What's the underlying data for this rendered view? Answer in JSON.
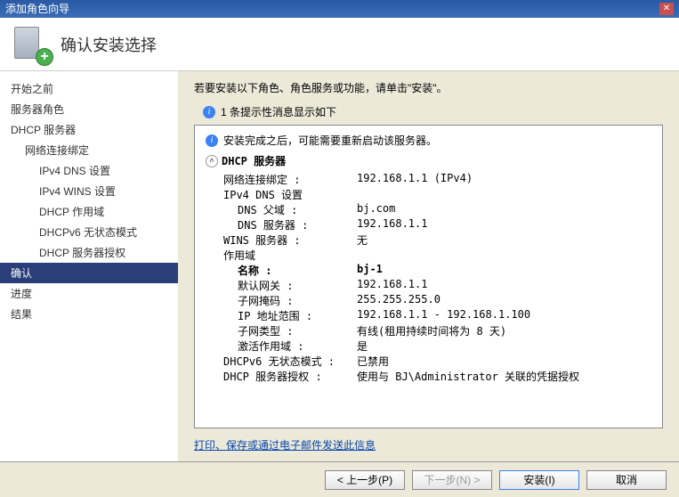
{
  "window": {
    "title": "添加角色向导"
  },
  "header": {
    "title": "确认安装选择"
  },
  "sidebar": {
    "items": [
      {
        "label": "开始之前",
        "level": 1
      },
      {
        "label": "服务器角色",
        "level": 1
      },
      {
        "label": "DHCP 服务器",
        "level": 1
      },
      {
        "label": "网络连接绑定",
        "level": 2
      },
      {
        "label": "IPv4 DNS 设置",
        "level": 3
      },
      {
        "label": "IPv4 WINS 设置",
        "level": 3
      },
      {
        "label": "DHCP 作用域",
        "level": 3
      },
      {
        "label": "DHCPv6 无状态模式",
        "level": 3
      },
      {
        "label": "DHCP 服务器授权",
        "level": 3
      },
      {
        "label": "确认",
        "level": 1,
        "selected": true
      },
      {
        "label": "进度",
        "level": 1
      },
      {
        "label": "结果",
        "level": 1
      }
    ]
  },
  "main": {
    "intro": "若要安装以下角色、角色服务或功能，请单击\"安装\"。",
    "info_line": "1 条提示性消息显示如下",
    "restart_line": "安装完成之后，可能需要重新启动该服务器。",
    "section_title": "DHCP 服务器",
    "rows": [
      {
        "k": "网络连接绑定 :",
        "v": "192.168.1.1 (IPv4)",
        "indent": 1
      },
      {
        "k": "IPv4 DNS 设置",
        "v": "",
        "indent": 1
      },
      {
        "k": "DNS 父域 :",
        "v": "bj.com",
        "indent": 2
      },
      {
        "k": "DNS 服务器 :",
        "v": "192.168.1.1",
        "indent": 2
      },
      {
        "k": "WINS 服务器 :",
        "v": "无",
        "indent": 1
      },
      {
        "k": "作用域",
        "v": "",
        "indent": 1
      },
      {
        "k": "名称 :",
        "v": "bj-1",
        "indent": 2,
        "bold": true
      },
      {
        "k": "默认网关 :",
        "v": "192.168.1.1",
        "indent": 2
      },
      {
        "k": "子网掩码 :",
        "v": "255.255.255.0",
        "indent": 2
      },
      {
        "k": "IP 地址范围 :",
        "v": "192.168.1.1 - 192.168.1.100",
        "indent": 2
      },
      {
        "k": "子网类型 :",
        "v": "有线(租用持续时间将为 8 天)",
        "indent": 2
      },
      {
        "k": "激活作用域 :",
        "v": "是",
        "indent": 2
      },
      {
        "k": "DHCPv6 无状态模式 :",
        "v": "已禁用",
        "indent": 1
      },
      {
        "k": "DHCP 服务器授权 :",
        "v": "使用与 BJ\\Administrator 关联的凭据授权",
        "indent": 1
      }
    ],
    "link_text": "打印、保存或通过电子邮件发送此信息"
  },
  "footer": {
    "prev": "< 上一步(P)",
    "next": "下一步(N) >",
    "install": "安装(I)",
    "cancel": "取消"
  }
}
